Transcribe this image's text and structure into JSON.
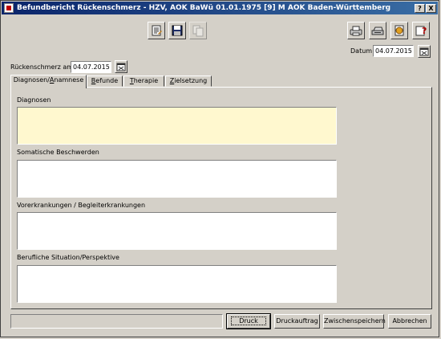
{
  "window": {
    "title": "Befundbericht Rückenschmerz - HZV, AOK BaWü 01.01.1975 [9] M AOK Baden-Württemberg",
    "help_label": "?",
    "close_label": "X"
  },
  "toolbar_left": [
    "notepad-icon",
    "save-icon",
    "copy-icon"
  ],
  "toolbar_right": [
    "print-icon",
    "scanner-icon",
    "export-icon",
    "help-icon"
  ],
  "datum": {
    "label": "Datum",
    "value": "04.07.2015"
  },
  "rueckenschmerz": {
    "label": "Rückenschmerz am",
    "value": "04.07.2015"
  },
  "tabs": {
    "diagnosen": {
      "pre": "Diagnosen/",
      "key": "A",
      "post": "namnese"
    },
    "befunde": {
      "pre": "",
      "key": "B",
      "post": "efunde"
    },
    "therapie": {
      "pre": "",
      "key": "T",
      "post": "herapie"
    },
    "zielsetzung": {
      "pre": "",
      "key": "Z",
      "post": "ielsetzung"
    }
  },
  "sections": {
    "diagnosen": {
      "label": "Diagnosen",
      "value": ""
    },
    "somatisch": {
      "label": "Somatische Beschwerden",
      "value": ""
    },
    "vorerkrankungen": {
      "label": "Vorerkrankungen / Begleiterkrankungen",
      "value": ""
    },
    "beruflich": {
      "label": "Berufliche Situation/Perspektive",
      "value": ""
    }
  },
  "buttons": {
    "druck": "Druck",
    "druckauftrag": "Druckauftrag",
    "zwischenspeichern": "Zwischenspeichern",
    "abbrechen": "Abbrechen"
  }
}
